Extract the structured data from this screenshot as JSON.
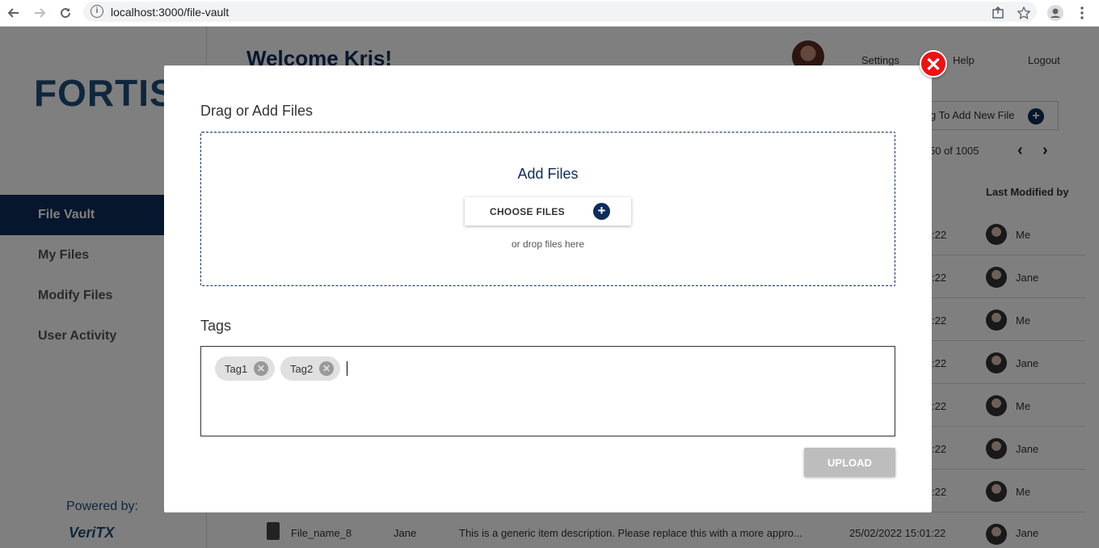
{
  "browser": {
    "url": "localhost:3000/file-vault"
  },
  "app": {
    "logo_text": "FORTIS",
    "welcome": "Welcome Kris!",
    "links": {
      "settings": "Settings",
      "help": "Help",
      "logout": "Logout"
    },
    "add_tag_label": "g To Add New File",
    "pager_text": "50 of 1005",
    "column_header": "Last Modified by",
    "sidebar": {
      "items": [
        {
          "label": "File Vault",
          "active": true
        },
        {
          "label": "My Files",
          "active": false
        },
        {
          "label": "Modify Files",
          "active": false
        },
        {
          "label": "User Activity",
          "active": false
        }
      ],
      "powered_by": "Powered by:",
      "brand": "VeriTX"
    },
    "rows": [
      {
        "time": ":22",
        "user": "Me"
      },
      {
        "time": ":22",
        "user": "Jane"
      },
      {
        "time": ":22",
        "user": "Me"
      },
      {
        "time": ":22",
        "user": "Jane"
      },
      {
        "time": ":22",
        "user": "Me"
      },
      {
        "time": ":22",
        "user": "Jane"
      },
      {
        "time": ":22",
        "user": "Me"
      }
    ],
    "bottom_row": {
      "filename": "File_name_8",
      "owner": "Jane",
      "description": "This is a generic item description. Please replace this with a more appro...",
      "date": "25/02/2022 15:01:22",
      "modified_by": "Jane"
    }
  },
  "modal": {
    "title": "Drag or Add Files",
    "dropzone_title": "Add Files",
    "choose_label": "CHOOSE FILES",
    "drop_hint": "or drop files here",
    "tags_title": "Tags",
    "tags": [
      "Tag1",
      "Tag2"
    ],
    "upload_label": "UPLOAD"
  },
  "colors": {
    "brand_navy": "#0d2d5a",
    "close_red": "#e11111"
  }
}
